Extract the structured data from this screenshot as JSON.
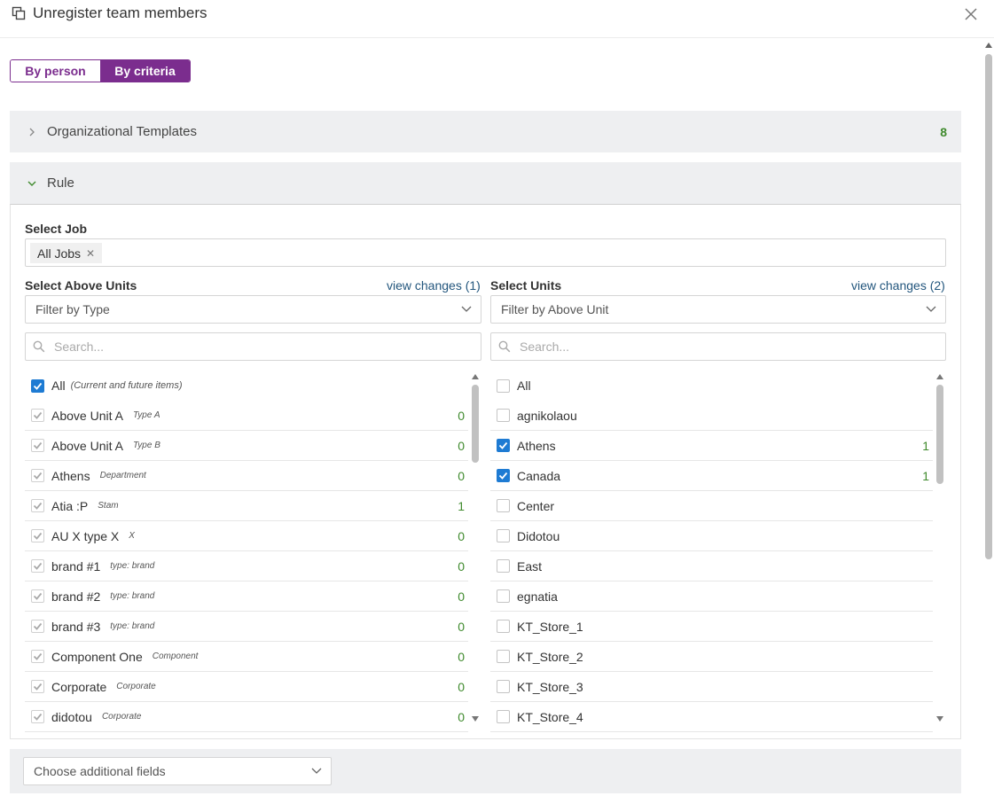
{
  "header": {
    "title": "Unregister team members"
  },
  "toggle": {
    "by_person": "By person",
    "by_criteria": "By criteria"
  },
  "panels": {
    "org_templates": {
      "label": "Organizational Templates",
      "count": "8"
    },
    "rule": {
      "label": "Rule"
    }
  },
  "job": {
    "label": "Select Job",
    "tags": [
      "All Jobs"
    ]
  },
  "above_units": {
    "label": "Select Above Units",
    "view_changes": "view changes (1)",
    "filter_placeholder": "Filter by Type",
    "search_placeholder": "Search...",
    "all_label": "All",
    "all_note": "(Current and future items)",
    "items": [
      {
        "name": "Above Unit A",
        "type": "Type A",
        "count": "0"
      },
      {
        "name": "Above Unit A",
        "type": "Type B",
        "count": "0"
      },
      {
        "name": "Athens",
        "type": "Department",
        "count": "0"
      },
      {
        "name": "Atia :P",
        "type": "Stam",
        "count": "1"
      },
      {
        "name": "AU X type X",
        "type": "X",
        "count": "0"
      },
      {
        "name": "brand #1",
        "type": "type: brand",
        "count": "0"
      },
      {
        "name": "brand #2",
        "type": "type: brand",
        "count": "0"
      },
      {
        "name": "brand #3",
        "type": "type: brand",
        "count": "0"
      },
      {
        "name": "Component One",
        "type": "Component",
        "count": "0"
      },
      {
        "name": "Corporate",
        "type": "Corporate",
        "count": "0"
      },
      {
        "name": "didotou",
        "type": "Corporate",
        "count": "0"
      }
    ]
  },
  "units": {
    "label": "Select Units",
    "view_changes": "view changes (2)",
    "filter_placeholder": "Filter by Above Unit",
    "search_placeholder": "Search...",
    "all_label": "All",
    "items": [
      {
        "name": "agnikolaou",
        "checked": false,
        "count": ""
      },
      {
        "name": "Athens",
        "checked": true,
        "count": "1"
      },
      {
        "name": "Canada",
        "checked": true,
        "count": "1"
      },
      {
        "name": "Center",
        "checked": false,
        "count": ""
      },
      {
        "name": "Didotou",
        "checked": false,
        "count": ""
      },
      {
        "name": "East",
        "checked": false,
        "count": ""
      },
      {
        "name": "egnatia",
        "checked": false,
        "count": ""
      },
      {
        "name": "KT_Store_1",
        "checked": false,
        "count": ""
      },
      {
        "name": "KT_Store_2",
        "checked": false,
        "count": ""
      },
      {
        "name": "KT_Store_3",
        "checked": false,
        "count": ""
      },
      {
        "name": "KT_Store_4",
        "checked": false,
        "count": ""
      }
    ]
  },
  "additional_fields": {
    "placeholder": "Choose additional fields"
  },
  "colors": {
    "accent": "#7b2d8e",
    "checkbox": "#1e7bd3",
    "count": "#3f8a2d",
    "link": "#23567d"
  },
  "icons": {
    "window": "window-copy-icon",
    "close": "close-icon",
    "chevron_right": "chevron-right-icon",
    "chevron_down": "chevron-down-icon",
    "search": "search-icon",
    "check": "checkmark-icon"
  }
}
